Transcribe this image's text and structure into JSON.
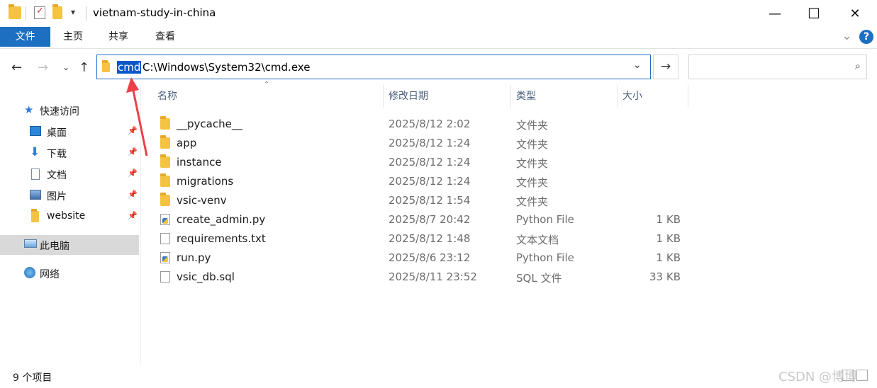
{
  "window": {
    "title": "vietnam-study-in-china",
    "min_glyph": "—",
    "max_glyph": "☐",
    "close_glyph": "✕"
  },
  "ribbon": {
    "tabs": [
      {
        "label": "文件",
        "active": true
      },
      {
        "label": "主页"
      },
      {
        "label": "共享"
      },
      {
        "label": "查看"
      }
    ],
    "help_glyph": "?",
    "collapse_glyph": "⌄"
  },
  "address": {
    "selected_text": "cmd",
    "rest_text": "C:\\Windows\\System32\\cmd.exe",
    "go_glyph": "→"
  },
  "search": {
    "placeholder": ""
  },
  "sidebar": {
    "items": [
      {
        "label": "快速访问",
        "icon": "star-icon"
      },
      {
        "label": "桌面",
        "icon": "desktop-icon",
        "pinned": true
      },
      {
        "label": "下载",
        "icon": "download-icon",
        "pinned": true
      },
      {
        "label": "文档",
        "icon": "document-icon",
        "pinned": true
      },
      {
        "label": "图片",
        "icon": "picture-icon",
        "pinned": true
      },
      {
        "label": "website",
        "icon": "folder-icon",
        "pinned": true
      },
      {
        "label": "此电脑",
        "icon": "computer-icon",
        "selected": true
      },
      {
        "label": "网络",
        "icon": "network-icon"
      }
    ]
  },
  "columns": {
    "name": "名称",
    "date": "修改日期",
    "type": "类型",
    "size": "大小"
  },
  "files": [
    {
      "name": "__pycache__",
      "date": "2025/8/12 2:02",
      "type": "文件夹",
      "size": "",
      "kind": "folder"
    },
    {
      "name": "app",
      "date": "2025/8/12 1:24",
      "type": "文件夹",
      "size": "",
      "kind": "folder"
    },
    {
      "name": "instance",
      "date": "2025/8/12 1:24",
      "type": "文件夹",
      "size": "",
      "kind": "folder"
    },
    {
      "name": "migrations",
      "date": "2025/8/12 1:24",
      "type": "文件夹",
      "size": "",
      "kind": "folder"
    },
    {
      "name": "vsic-venv",
      "date": "2025/8/12 1:54",
      "type": "文件夹",
      "size": "",
      "kind": "folder"
    },
    {
      "name": "create_admin.py",
      "date": "2025/8/7 20:42",
      "type": "Python File",
      "size": "1 KB",
      "kind": "python"
    },
    {
      "name": "requirements.txt",
      "date": "2025/8/12 1:48",
      "type": "文本文档",
      "size": "1 KB",
      "kind": "text"
    },
    {
      "name": "run.py",
      "date": "2025/8/6 23:12",
      "type": "Python File",
      "size": "1 KB",
      "kind": "python"
    },
    {
      "name": "vsic_db.sql",
      "date": "2025/8/11 23:52",
      "type": "SQL 文件",
      "size": "33 KB",
      "kind": "file"
    }
  ],
  "status": {
    "item_count": "9 个项目"
  },
  "watermark": "CSDN @博博",
  "colors": {
    "accent": "#1d6fc2",
    "selection": "#0a58c8",
    "folder": "#f5c342",
    "annotation_arrow": "#ec3f4a"
  }
}
